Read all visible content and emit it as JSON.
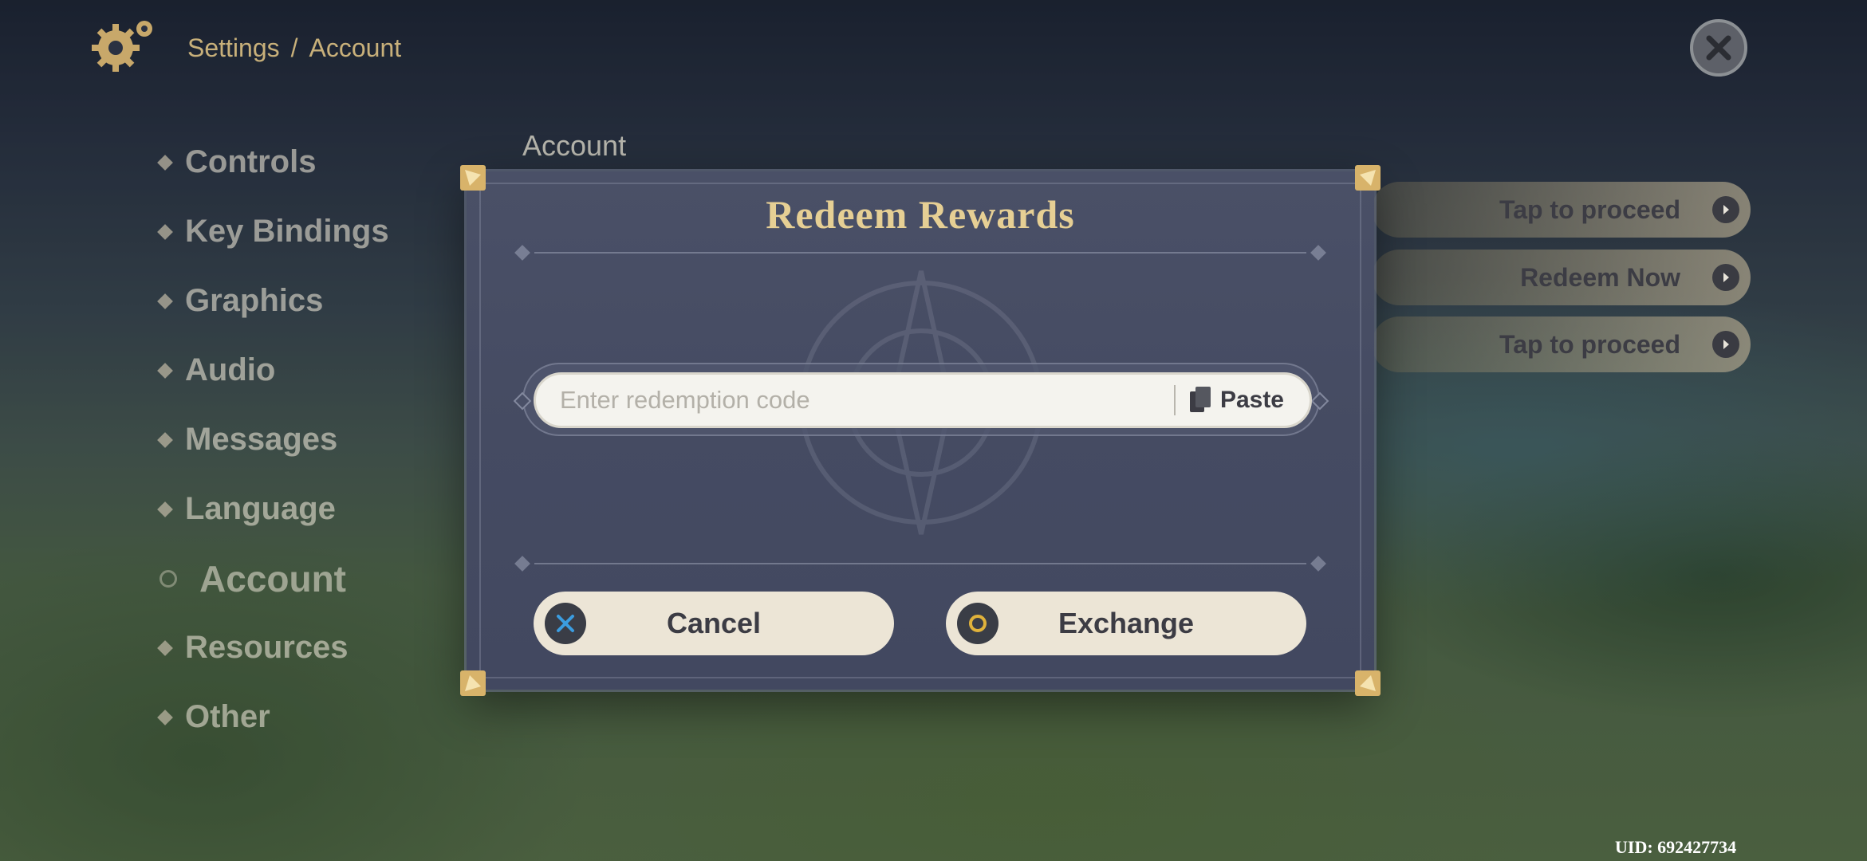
{
  "header": {
    "breadcrumb_root": "Settings",
    "breadcrumb_sep": "/",
    "breadcrumb_current": "Account"
  },
  "nav": {
    "items": [
      {
        "label": "Controls"
      },
      {
        "label": "Key Bindings"
      },
      {
        "label": "Graphics"
      },
      {
        "label": "Audio"
      },
      {
        "label": "Messages"
      },
      {
        "label": "Language"
      },
      {
        "label": "Account",
        "active": true
      },
      {
        "label": "Resources"
      },
      {
        "label": "Other"
      }
    ]
  },
  "section": {
    "title": "Account"
  },
  "actions": [
    {
      "label": "Tap to proceed"
    },
    {
      "label": "Redeem Now"
    },
    {
      "label": "Tap to proceed"
    }
  ],
  "dialog": {
    "title": "Redeem Rewards",
    "code_input": {
      "value": "",
      "placeholder": "Enter redemption code"
    },
    "paste_label": "Paste",
    "cancel_label": "Cancel",
    "exchange_label": "Exchange"
  },
  "footer": {
    "uid": "UID: 692427734"
  },
  "colors": {
    "dialog_bg": "#474d64",
    "title_gold": "#e6cf94",
    "button_bg": "#ece5d6",
    "cancel_icon_accent": "#3b9de0",
    "exchange_icon_accent": "#e0b23b"
  },
  "icons": {
    "settings": "gear-icon",
    "close": "close-icon",
    "paste": "clipboard-icon",
    "cancel": "x-icon",
    "exchange": "circle-icon",
    "pill_arrow": "arrow-right-icon"
  }
}
